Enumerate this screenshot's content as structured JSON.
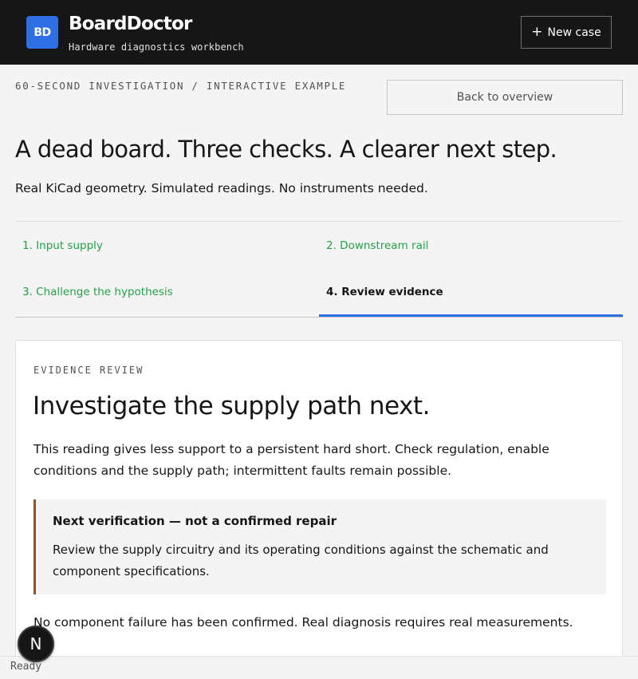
{
  "header": {
    "logo_text": "BD",
    "brand_name": "BoardDoctor",
    "brand_subtitle": "Hardware diagnostics workbench",
    "new_case_label": "New case"
  },
  "page": {
    "eyebrow": "60-SECOND INVESTIGATION / INTERACTIVE EXAMPLE",
    "back_label": "Back to overview",
    "title": "A dead board. Three checks. A clearer next step.",
    "subtitle": "Real KiCad geometry. Simulated readings. No instruments needed."
  },
  "steps": [
    {
      "label": "1. Input supply",
      "state": "complete"
    },
    {
      "label": "2. Downstream rail",
      "state": "complete"
    },
    {
      "label": "3. Challenge the hypothesis",
      "state": "complete"
    },
    {
      "label": "4. Review evidence",
      "state": "active"
    }
  ],
  "evidence": {
    "eyebrow": "EVIDENCE REVIEW",
    "title": "Investigate the supply path next.",
    "body": "This reading gives less support to a persistent hard short. Check regulation, enable conditions and the supply path; intermittent faults remain possible.",
    "callout_title": "Next verification — not a confirmed repair",
    "callout_body": "Review the supply circuitry and its operating conditions against the schematic and component specifications.",
    "disclaimer": "No component failure has been confirmed. Real diagnosis requires real measurements."
  },
  "status": {
    "badge_letter": "N",
    "text": "Ready"
  },
  "colors": {
    "header_bg": "#161616",
    "accent_blue": "#2f6fe6",
    "complete_green": "#24a148",
    "callout_border": "#8a5a1c"
  }
}
